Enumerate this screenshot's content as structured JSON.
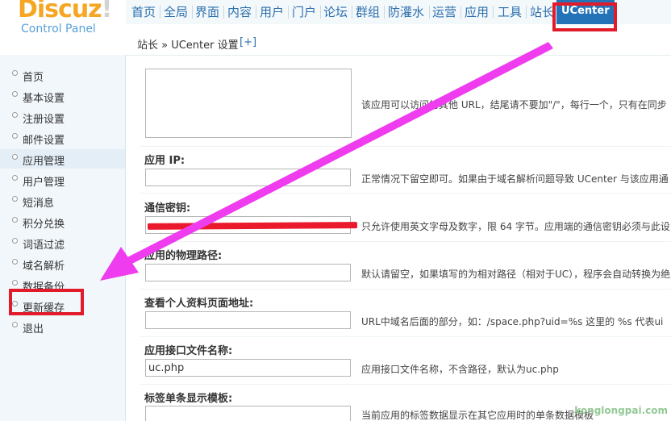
{
  "header": {
    "logo_main": "Discuz",
    "logo_bang": "!",
    "logo_sub": "Control Panel",
    "nav": [
      "首页",
      "全局",
      "界面",
      "内容",
      "用户",
      "门户",
      "论坛",
      "群组",
      "防灌水",
      "运营",
      "应用",
      "工具",
      "站长"
    ],
    "nav_active": "UCenter"
  },
  "breadcrumb": {
    "text": "站长 » UCenter 设置",
    "add": "[+]"
  },
  "sidebar": {
    "items": [
      "首页",
      "基本设置",
      "注册设置",
      "邮件设置",
      "应用管理",
      "用户管理",
      "短消息",
      "积分兑换",
      "词语过滤",
      "域名解析",
      "数据备份",
      "更新缓存",
      "退出"
    ],
    "active_index": 4
  },
  "form": {
    "other_urls_desc": "该应用可以访问的其他 URL，结尾请不要加\"/\"，每行一个，只有在同步",
    "ip": {
      "label": "应用 IP:",
      "value": "",
      "desc": "正常情况下留空即可。如果由于域名解析问题导致 UCenter 与该应用通"
    },
    "key": {
      "label": "通信密钥:",
      "value": "",
      "desc": "只允许使用英文字母及数字，限 64 字节。应用端的通信密钥必须与此设"
    },
    "path": {
      "label": "应用的物理路径:",
      "value": "",
      "desc": "默认请留空，如果填写的为相对路径（相对于UC），程序会自动转换为绝"
    },
    "profile": {
      "label": "查看个人资料页面地址:",
      "value": "",
      "desc": "URL中域名后面的部分，如：/space.php?uid=%s 这里的 %s 代表ui"
    },
    "api": {
      "label": "应用接口文件名称:",
      "value": "uc.php",
      "desc": "应用接口文件名称，不含路径，默认为uc.php"
    },
    "tpl": {
      "label": "标签单条显示模板:",
      "value": "",
      "desc": "当前应用的标签数据显示在其它应用时的单条数据模板"
    }
  },
  "watermark": "konglongpai.com",
  "colors": {
    "nav_active_bg": "#2472b8",
    "annotation_red": "#e21b2b",
    "arrow_magenta": "#ee3cee"
  }
}
